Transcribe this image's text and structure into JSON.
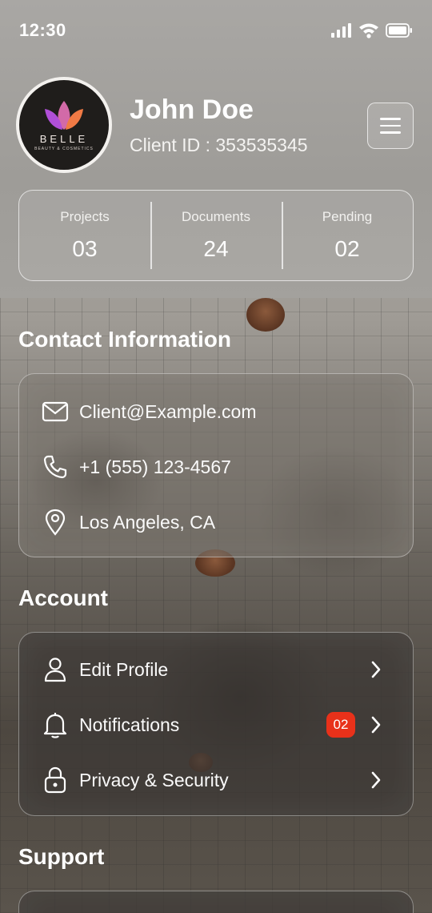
{
  "status_bar": {
    "time": "12:30"
  },
  "profile": {
    "brand_name": "BELLE",
    "brand_tagline": "BEAUTY & COSMETICS",
    "name": "John Doe",
    "client_id": "Client ID : 353535345"
  },
  "stats": [
    {
      "label": "Projects",
      "value": "03"
    },
    {
      "label": "Documents",
      "value": "24"
    },
    {
      "label": "Pending",
      "value": "02"
    }
  ],
  "contact": {
    "title": "Contact Information",
    "email": "Client@Example.com",
    "phone": "+1 (555) 123-4567",
    "location": "Los Angeles, CA"
  },
  "account": {
    "title": "Account",
    "items": [
      {
        "label": "Edit Profile",
        "icon": "user-icon"
      },
      {
        "label": "Notifications",
        "icon": "bell-icon",
        "badge": "02"
      },
      {
        "label": "Privacy & Security",
        "icon": "lock-icon"
      }
    ]
  },
  "support": {
    "title": "Support"
  },
  "colors": {
    "badge": "#e8311a",
    "logo_petal_left": "#b04fd8",
    "logo_petal_right": "#f07a45"
  }
}
